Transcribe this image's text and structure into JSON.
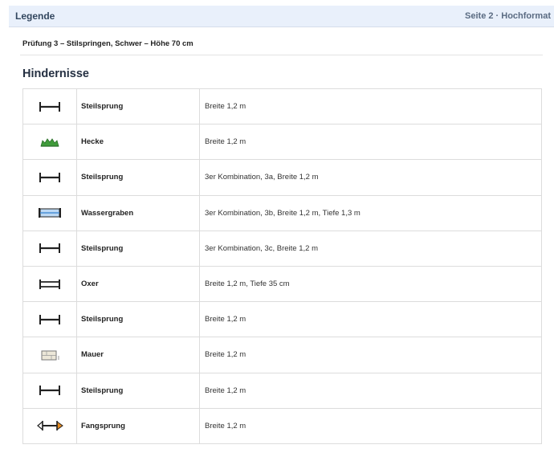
{
  "header": {
    "title": "Legende",
    "page_info": "Seite 2 · Hochformat"
  },
  "subtitle": "Prüfung 3 – Stilspringen, Schwer – Höhe 70 cm",
  "section_title": "Hindernisse",
  "obstacles": [
    {
      "icon": "steilsprung-icon",
      "name": "Steilsprung",
      "description": "Breite 1,2 m"
    },
    {
      "icon": "hecke-icon",
      "name": "Hecke",
      "description": "Breite 1,2 m"
    },
    {
      "icon": "steilsprung-icon",
      "name": "Steilsprung",
      "description": "3er Kombination, 3a, Breite 1,2 m"
    },
    {
      "icon": "wassergraben-icon",
      "name": "Wassergraben",
      "description": "3er Kombination, 3b, Breite 1,2 m, Tiefe 1,3 m"
    },
    {
      "icon": "steilsprung-icon",
      "name": "Steilsprung",
      "description": "3er Kombination, 3c, Breite 1,2 m"
    },
    {
      "icon": "oxer-icon",
      "name": "Oxer",
      "description": "Breite 1,2 m, Tiefe 35 cm"
    },
    {
      "icon": "steilsprung-icon",
      "name": "Steilsprung",
      "description": "Breite 1,2 m"
    },
    {
      "icon": "mauer-icon",
      "name": "Mauer",
      "description": "Breite 1,2 m"
    },
    {
      "icon": "steilsprung-icon",
      "name": "Steilsprung",
      "description": "Breite 1,2 m"
    },
    {
      "icon": "fangsprung-icon",
      "name": "Fangsprung",
      "description": "Breite 1,2 m"
    }
  ],
  "colors": {
    "header_bg": "#e9f0fb",
    "hecke_green": "#3f9b3a",
    "water_blue": "#4a8fd6",
    "fangsprung_orange": "#e58a1f"
  }
}
